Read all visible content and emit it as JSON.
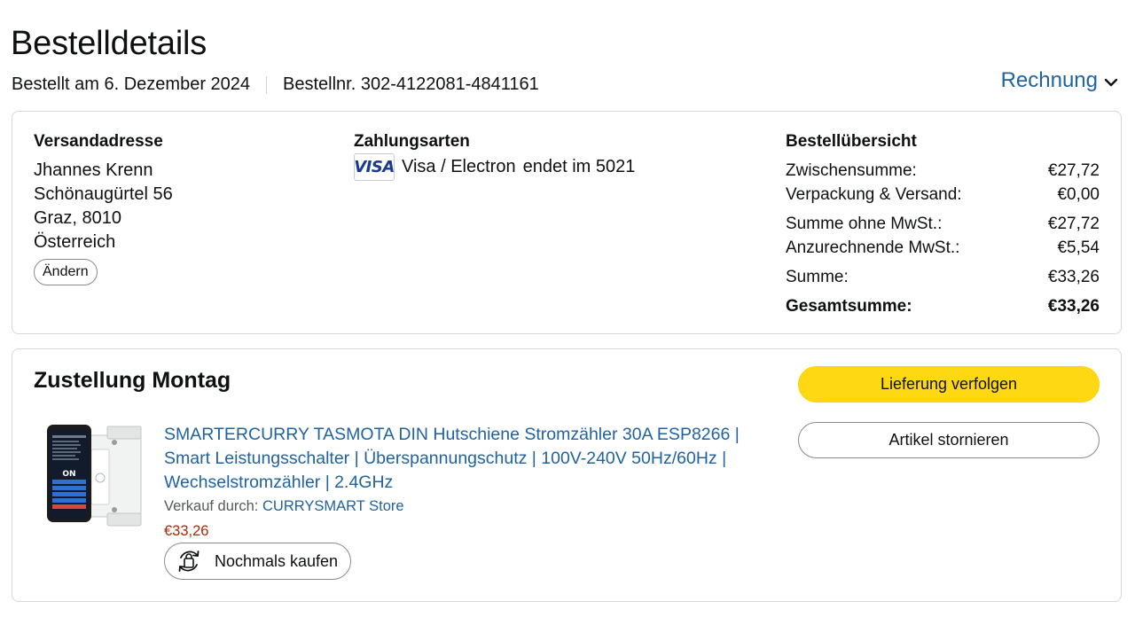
{
  "header": {
    "title": "Bestelldetails",
    "order_date": "Bestellt am 6. Dezember 2024",
    "order_number": "Bestellnr. 302-4122081-4841161",
    "invoice_label": "Rechnung"
  },
  "shipping": {
    "title": "Versandadresse",
    "name": "Jhannes Krenn",
    "street": "Schönaugürtel 56",
    "city": "Graz, 8010",
    "country": "Österreich",
    "change_label": "Ändern"
  },
  "payment": {
    "title": "Zahlungsarten",
    "card_brand": "VISA",
    "card_type": "Visa / Electron",
    "card_ending": "endet im 5021"
  },
  "summary": {
    "title": "Bestellübersicht",
    "rows": [
      {
        "label": "Zwischensumme:",
        "value": "€27,72"
      },
      {
        "label": "Verpackung & Versand:",
        "value": "€0,00"
      },
      {
        "label": "Summe ohne MwSt.:",
        "value": "€27,72"
      },
      {
        "label": "Anzurechnende MwSt.:",
        "value": "€5,54"
      },
      {
        "label": "Summe:",
        "value": "€33,26"
      },
      {
        "label": "Gesamtsumme:",
        "value": "€33,26"
      }
    ]
  },
  "delivery": {
    "title": "Zustellung Montag",
    "track_label": "Lieferung verfolgen",
    "cancel_label": "Artikel stornieren",
    "product": {
      "title": "SMARTERCURRY TASMOTA DIN Hutschiene Stromzähler 30A ESP8266 | Smart Leistungsschalter | Überspannungschutz | 100V-240V 50Hz/60Hz | Wechselstromzähler | 2.4GHz",
      "sold_by_label": "Verkauf durch:",
      "seller": "CURRYSMART Store",
      "price": "€33,26",
      "buy_again_label": "Nochmals kaufen",
      "image_screen_label": "ON"
    }
  },
  "colors": {
    "link": "#2162a1",
    "price": "#b12704",
    "primary_button": "#ffd814",
    "border": "#d5d9d9"
  }
}
